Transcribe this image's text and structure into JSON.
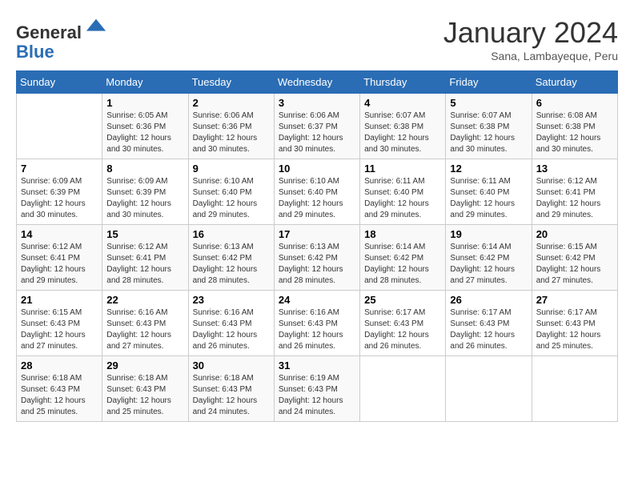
{
  "header": {
    "logo_line1": "General",
    "logo_line2": "Blue",
    "month_title": "January 2024",
    "subtitle": "Sana, Lambayeque, Peru"
  },
  "weekdays": [
    "Sunday",
    "Monday",
    "Tuesday",
    "Wednesday",
    "Thursday",
    "Friday",
    "Saturday"
  ],
  "weeks": [
    [
      {
        "day": "",
        "sunrise": "",
        "sunset": "",
        "daylight": ""
      },
      {
        "day": "1",
        "sunrise": "Sunrise: 6:05 AM",
        "sunset": "Sunset: 6:36 PM",
        "daylight": "Daylight: 12 hours and 30 minutes."
      },
      {
        "day": "2",
        "sunrise": "Sunrise: 6:06 AM",
        "sunset": "Sunset: 6:36 PM",
        "daylight": "Daylight: 12 hours and 30 minutes."
      },
      {
        "day": "3",
        "sunrise": "Sunrise: 6:06 AM",
        "sunset": "Sunset: 6:37 PM",
        "daylight": "Daylight: 12 hours and 30 minutes."
      },
      {
        "day": "4",
        "sunrise": "Sunrise: 6:07 AM",
        "sunset": "Sunset: 6:38 PM",
        "daylight": "Daylight: 12 hours and 30 minutes."
      },
      {
        "day": "5",
        "sunrise": "Sunrise: 6:07 AM",
        "sunset": "Sunset: 6:38 PM",
        "daylight": "Daylight: 12 hours and 30 minutes."
      },
      {
        "day": "6",
        "sunrise": "Sunrise: 6:08 AM",
        "sunset": "Sunset: 6:38 PM",
        "daylight": "Daylight: 12 hours and 30 minutes."
      }
    ],
    [
      {
        "day": "7",
        "sunrise": "Sunrise: 6:09 AM",
        "sunset": "Sunset: 6:39 PM",
        "daylight": "Daylight: 12 hours and 30 minutes."
      },
      {
        "day": "8",
        "sunrise": "Sunrise: 6:09 AM",
        "sunset": "Sunset: 6:39 PM",
        "daylight": "Daylight: 12 hours and 30 minutes."
      },
      {
        "day": "9",
        "sunrise": "Sunrise: 6:10 AM",
        "sunset": "Sunset: 6:40 PM",
        "daylight": "Daylight: 12 hours and 29 minutes."
      },
      {
        "day": "10",
        "sunrise": "Sunrise: 6:10 AM",
        "sunset": "Sunset: 6:40 PM",
        "daylight": "Daylight: 12 hours and 29 minutes."
      },
      {
        "day": "11",
        "sunrise": "Sunrise: 6:11 AM",
        "sunset": "Sunset: 6:40 PM",
        "daylight": "Daylight: 12 hours and 29 minutes."
      },
      {
        "day": "12",
        "sunrise": "Sunrise: 6:11 AM",
        "sunset": "Sunset: 6:40 PM",
        "daylight": "Daylight: 12 hours and 29 minutes."
      },
      {
        "day": "13",
        "sunrise": "Sunrise: 6:12 AM",
        "sunset": "Sunset: 6:41 PM",
        "daylight": "Daylight: 12 hours and 29 minutes."
      }
    ],
    [
      {
        "day": "14",
        "sunrise": "Sunrise: 6:12 AM",
        "sunset": "Sunset: 6:41 PM",
        "daylight": "Daylight: 12 hours and 29 minutes."
      },
      {
        "day": "15",
        "sunrise": "Sunrise: 6:12 AM",
        "sunset": "Sunset: 6:41 PM",
        "daylight": "Daylight: 12 hours and 28 minutes."
      },
      {
        "day": "16",
        "sunrise": "Sunrise: 6:13 AM",
        "sunset": "Sunset: 6:42 PM",
        "daylight": "Daylight: 12 hours and 28 minutes."
      },
      {
        "day": "17",
        "sunrise": "Sunrise: 6:13 AM",
        "sunset": "Sunset: 6:42 PM",
        "daylight": "Daylight: 12 hours and 28 minutes."
      },
      {
        "day": "18",
        "sunrise": "Sunrise: 6:14 AM",
        "sunset": "Sunset: 6:42 PM",
        "daylight": "Daylight: 12 hours and 28 minutes."
      },
      {
        "day": "19",
        "sunrise": "Sunrise: 6:14 AM",
        "sunset": "Sunset: 6:42 PM",
        "daylight": "Daylight: 12 hours and 27 minutes."
      },
      {
        "day": "20",
        "sunrise": "Sunrise: 6:15 AM",
        "sunset": "Sunset: 6:42 PM",
        "daylight": "Daylight: 12 hours and 27 minutes."
      }
    ],
    [
      {
        "day": "21",
        "sunrise": "Sunrise: 6:15 AM",
        "sunset": "Sunset: 6:43 PM",
        "daylight": "Daylight: 12 hours and 27 minutes."
      },
      {
        "day": "22",
        "sunrise": "Sunrise: 6:16 AM",
        "sunset": "Sunset: 6:43 PM",
        "daylight": "Daylight: 12 hours and 27 minutes."
      },
      {
        "day": "23",
        "sunrise": "Sunrise: 6:16 AM",
        "sunset": "Sunset: 6:43 PM",
        "daylight": "Daylight: 12 hours and 26 minutes."
      },
      {
        "day": "24",
        "sunrise": "Sunrise: 6:16 AM",
        "sunset": "Sunset: 6:43 PM",
        "daylight": "Daylight: 12 hours and 26 minutes."
      },
      {
        "day": "25",
        "sunrise": "Sunrise: 6:17 AM",
        "sunset": "Sunset: 6:43 PM",
        "daylight": "Daylight: 12 hours and 26 minutes."
      },
      {
        "day": "26",
        "sunrise": "Sunrise: 6:17 AM",
        "sunset": "Sunset: 6:43 PM",
        "daylight": "Daylight: 12 hours and 26 minutes."
      },
      {
        "day": "27",
        "sunrise": "Sunrise: 6:17 AM",
        "sunset": "Sunset: 6:43 PM",
        "daylight": "Daylight: 12 hours and 25 minutes."
      }
    ],
    [
      {
        "day": "28",
        "sunrise": "Sunrise: 6:18 AM",
        "sunset": "Sunset: 6:43 PM",
        "daylight": "Daylight: 12 hours and 25 minutes."
      },
      {
        "day": "29",
        "sunrise": "Sunrise: 6:18 AM",
        "sunset": "Sunset: 6:43 PM",
        "daylight": "Daylight: 12 hours and 25 minutes."
      },
      {
        "day": "30",
        "sunrise": "Sunrise: 6:18 AM",
        "sunset": "Sunset: 6:43 PM",
        "daylight": "Daylight: 12 hours and 24 minutes."
      },
      {
        "day": "31",
        "sunrise": "Sunrise: 6:19 AM",
        "sunset": "Sunset: 6:43 PM",
        "daylight": "Daylight: 12 hours and 24 minutes."
      },
      {
        "day": "",
        "sunrise": "",
        "sunset": "",
        "daylight": ""
      },
      {
        "day": "",
        "sunrise": "",
        "sunset": "",
        "daylight": ""
      },
      {
        "day": "",
        "sunrise": "",
        "sunset": "",
        "daylight": ""
      }
    ]
  ]
}
